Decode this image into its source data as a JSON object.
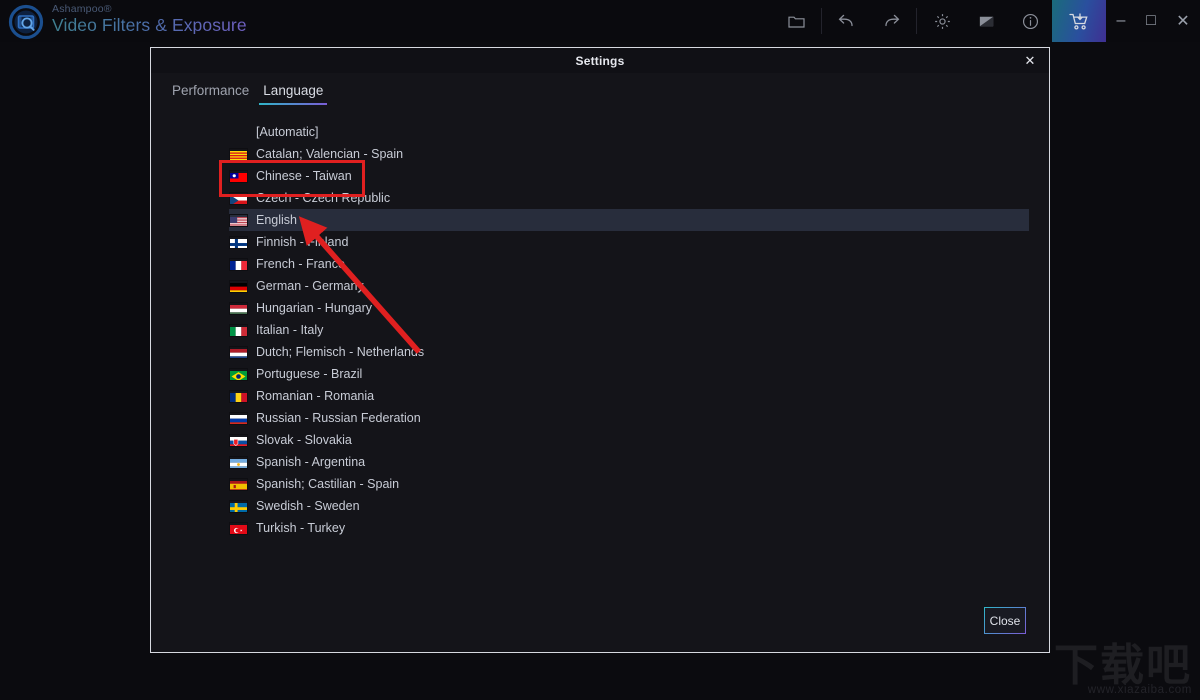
{
  "app": {
    "brand_sup": "Ashampoo®",
    "brand_name": "Video Filters & Exposure",
    "logo_icon": "video-filters-logo-icon"
  },
  "toolbar": {
    "items": [
      {
        "name": "folder-icon",
        "label": "Open folder"
      },
      {
        "name": "undo-icon",
        "label": "Undo"
      },
      {
        "name": "redo-icon",
        "label": "Redo"
      },
      {
        "name": "gear-icon",
        "label": "Settings"
      },
      {
        "name": "contrast-icon",
        "label": "Compare"
      },
      {
        "name": "info-icon",
        "label": "Info"
      },
      {
        "name": "cart-icon",
        "label": "Buy"
      }
    ],
    "window_controls": [
      {
        "name": "minimize-icon",
        "glyph": "–"
      },
      {
        "name": "maximize-icon",
        "glyph": "□"
      },
      {
        "name": "close-icon",
        "glyph": "✕"
      }
    ]
  },
  "dialog": {
    "title": "Settings",
    "close_glyph": "✕",
    "tabs": [
      {
        "label": "Performance",
        "active": false
      },
      {
        "label": "Language",
        "active": true
      }
    ],
    "close_button": "Close"
  },
  "languages": [
    {
      "label": "[Automatic]",
      "flag": "none",
      "selected": false
    },
    {
      "label": "Catalan; Valencian - Spain",
      "flag": "catalonia",
      "selected": false
    },
    {
      "label": "Chinese - Taiwan",
      "flag": "taiwan",
      "selected": false
    },
    {
      "label": "Czech - Czech Republic",
      "flag": "czech",
      "selected": false
    },
    {
      "label": "English",
      "flag": "usa",
      "selected": true
    },
    {
      "label": "Finnish - Finland",
      "flag": "finland",
      "selected": false
    },
    {
      "label": "French - France",
      "flag": "france",
      "selected": false
    },
    {
      "label": "German - Germany",
      "flag": "germany",
      "selected": false
    },
    {
      "label": "Hungarian - Hungary",
      "flag": "hungary",
      "selected": false
    },
    {
      "label": "Italian - Italy",
      "flag": "italy",
      "selected": false
    },
    {
      "label": "Dutch; Flemisch - Netherlands",
      "flag": "netherlands",
      "selected": false
    },
    {
      "label": "Portuguese - Brazil",
      "flag": "brazil",
      "selected": false
    },
    {
      "label": "Romanian - Romania",
      "flag": "romania",
      "selected": false
    },
    {
      "label": "Russian - Russian Federation",
      "flag": "russia",
      "selected": false
    },
    {
      "label": "Slovak - Slovakia",
      "flag": "slovakia",
      "selected": false
    },
    {
      "label": "Spanish - Argentina",
      "flag": "argentina",
      "selected": false
    },
    {
      "label": "Spanish; Castilian - Spain",
      "flag": "spain",
      "selected": false
    },
    {
      "label": "Swedish - Sweden",
      "flag": "sweden",
      "selected": false
    },
    {
      "label": "Turkish - Turkey",
      "flag": "turkey",
      "selected": false
    }
  ],
  "annotations": {
    "highlight_rect_target": "Chinese - Taiwan",
    "arrow_points_to": "English",
    "color": "#e02020"
  },
  "watermark": {
    "text": "下载吧",
    "url": "www.xiazaiba.com"
  },
  "colors": {
    "window_bg": "#0b0b0f",
    "dialog_bg": "#141419",
    "selection": "#282d3c",
    "accent_start": "#2fb6c8",
    "accent_end": "#7b5cd6",
    "annotation": "#e02020"
  }
}
